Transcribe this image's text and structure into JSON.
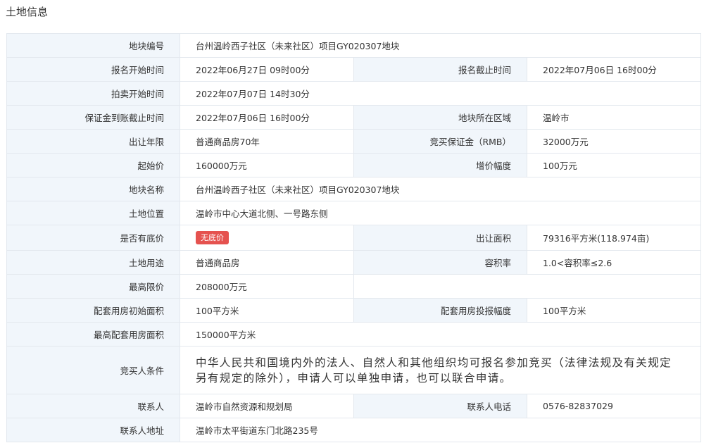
{
  "page": {
    "title": "土地信息"
  },
  "rows": {
    "r1": {
      "label": "地块编号",
      "value": "台州温岭西子社区（未来社区）项目GY020307地块"
    },
    "r2": {
      "label_a": "报名开始时间",
      "value_a": "2022年06月27日 09时00分",
      "label_b": "报名截止时间",
      "value_b": "2022年07月06日 16时00分"
    },
    "r3": {
      "label": "拍卖开始时间",
      "value": "2022年07月07日 14时30分"
    },
    "r4": {
      "label_a": "保证金到账截止时间",
      "value_a": "2022年07月06日 16时00分",
      "label_b": "地块所在区域",
      "value_b": "温岭市"
    },
    "r5": {
      "label_a": "出让年限",
      "value_a": "普通商品房70年",
      "label_b": "竞买保证金（RMB）",
      "value_b": "32000万元"
    },
    "r6": {
      "label_a": "起始价",
      "value_a": "160000万元",
      "label_b": "增价幅度",
      "value_b": "100万元"
    },
    "r7": {
      "label": "地块名称",
      "value": "台州温岭西子社区（未来社区）项目GY020307地块"
    },
    "r8": {
      "label": "土地位置",
      "value": "温岭市中心大道北侧、一号路东侧"
    },
    "r9": {
      "label_a": "是否有底价",
      "badge": "无底价",
      "label_b": "出让面积",
      "value_b": "79316平方米(118.974亩)"
    },
    "r10": {
      "label_a": "土地用途",
      "value_a": "普通商品房",
      "label_b": "容积率",
      "value_b": "1.0<容积率≤2.6"
    },
    "r11": {
      "label": "最高限价",
      "value": "208000万元"
    },
    "r12": {
      "label_a": "配套用房初始面积",
      "value_a": "100平方米",
      "label_b": "配套用房投报幅度",
      "value_b": "100平方米"
    },
    "r13": {
      "label": "最高配套用房面积",
      "value": "150000平方米"
    },
    "r14": {
      "label": "竞买人条件",
      "value": "中华人民共和国境内外的法人、自然人和其他组织均可报名参加竞买（法律法规及有关规定另有规定的除外），申请人可以单独申请，也可以联合申请。"
    },
    "r15": {
      "label_a": "联系人",
      "value_a": "温岭市自然资源和规划局",
      "label_b": "联系人电话",
      "value_b": "0576-82837029"
    },
    "r16": {
      "label": "联系人地址",
      "value": "温岭市太平街道东门北路235号"
    }
  },
  "colors": {
    "label_bg": "#f1f6fb",
    "border": "#e3e8ee",
    "badge_bg": "#e5524f"
  }
}
